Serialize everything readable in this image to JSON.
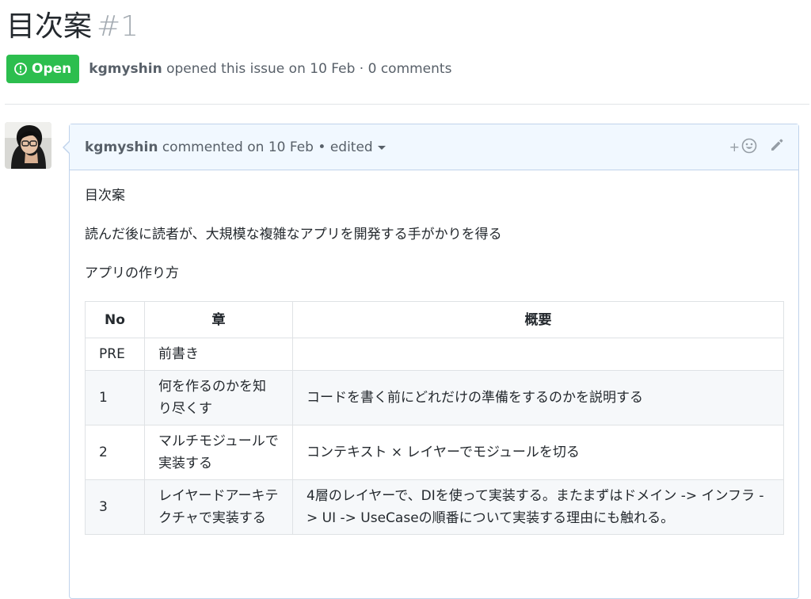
{
  "issue": {
    "title": "目次案",
    "number": "#1",
    "state": "Open",
    "author": "kgmyshin",
    "meta_rest": "opened this issue on 10 Feb · 0 comments"
  },
  "comment": {
    "author": "kgmyshin",
    "meta": "commented on 10 Feb",
    "separator": "•",
    "edited_label": "edited",
    "reaction_plus": "+",
    "body": {
      "p1": "目次案",
      "p2": "読んだ後に読者が、大規模な複雑なアプリを開発する手がかりを得る",
      "p3": "アプリの作り方"
    },
    "table": {
      "headers": [
        "No",
        "章",
        "概要"
      ],
      "rows": [
        [
          "PRE",
          "前書き",
          ""
        ],
        [
          "1",
          "何を作るのかを知り尽くす",
          "コードを書く前にどれだけの準備をするのかを説明する"
        ],
        [
          "2",
          "マルチモジュールで実装する",
          "コンテキスト × レイヤーでモジュールを切る"
        ],
        [
          "3",
          "レイヤードアーキテクチャで実装する",
          "4層のレイヤーで、DIを使って実装する。またまずはドメイン -> インフラ -> UI -> UseCaseの順番について実装する理由にも触れる。"
        ]
      ]
    }
  },
  "colors": {
    "open_badge": "#2cbe4e",
    "comment_header_bg": "#f1f8ff",
    "comment_border": "#c0d3eb",
    "muted_text": "#586069",
    "number_gray": "#a3aab1"
  },
  "icons": {
    "state": "issue-opened-icon",
    "reaction": "smiley-icon",
    "edit": "pencil-icon",
    "dropdown": "caret-down-icon"
  }
}
